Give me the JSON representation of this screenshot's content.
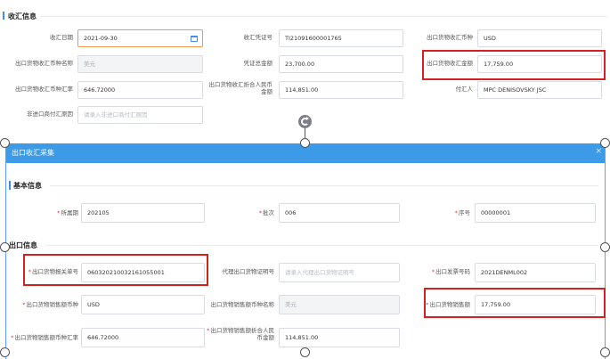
{
  "receipt_section": {
    "title": "收汇信息",
    "fields": {
      "receipt_date": {
        "label": "收汇日期",
        "value": "2021-09-30"
      },
      "receipt_voucher_no": {
        "label": "收汇凭证号",
        "value": "TI21091600001765"
      },
      "export_receipt_currency": {
        "label": "出口货物收汇币种",
        "value": "USD"
      },
      "export_receipt_currency_name": {
        "label": "出口货物收汇币种名称",
        "value": "美元"
      },
      "voucher_total": {
        "label": "凭证总金额",
        "value": "23,700.00"
      },
      "export_receipt_amount": {
        "label": "出口货物收汇金额",
        "value": "17,759.00"
      },
      "export_receipt_rate": {
        "label": "出口货物收汇币种汇率",
        "value": "646.72000"
      },
      "export_receipt_cny": {
        "label": "出口货物收汇折合人民币金额",
        "value": "114,851.00"
      },
      "payer": {
        "label": "付汇人",
        "value": "MPC DENISOVSKY JSC"
      },
      "non_import_reason": {
        "label": "非进口商付汇原因",
        "placeholder": "请录入非进口商付汇原因"
      }
    }
  },
  "dialog": {
    "title": "出口收汇采集",
    "close_glyph": "×",
    "basic_section": {
      "title": "基本信息",
      "fields": {
        "period": {
          "label": "所属期",
          "value": "202105"
        },
        "batch": {
          "label": "批次",
          "value": "006"
        },
        "seq": {
          "label": "序号",
          "value": "00000001"
        }
      }
    },
    "export_section": {
      "title": "出口信息",
      "fields": {
        "customs_decl_no": {
          "label": "出口货物报关单号",
          "value": "060320210032161055001"
        },
        "agent_cert_no": {
          "label": "代理出口货物证明号",
          "placeholder": "请录入代理出口货物证明号"
        },
        "invoice_no": {
          "label": "出口发票号码",
          "value": "2021DENML002"
        },
        "sales_currency": {
          "label": "出口货物销售额币种",
          "value": "USD"
        },
        "sales_currency_name": {
          "label": "出口货物销售额币种名称",
          "value": "美元"
        },
        "sales_amount": {
          "label": "出口货物销售额",
          "value": "17,759.00"
        },
        "sales_rate": {
          "label": "出口货物销售额币种汇率",
          "value": "646.72000"
        },
        "sales_cny": {
          "label": "出口货物销售额折合人民币金额",
          "value": "114,851.00"
        }
      }
    }
  },
  "colors": {
    "accent": "#3d9ae6",
    "highlight": "#d62020",
    "required": "#e23a3a"
  },
  "icons": [
    "calendar-icon",
    "rotate-icon",
    "close-icon"
  ]
}
